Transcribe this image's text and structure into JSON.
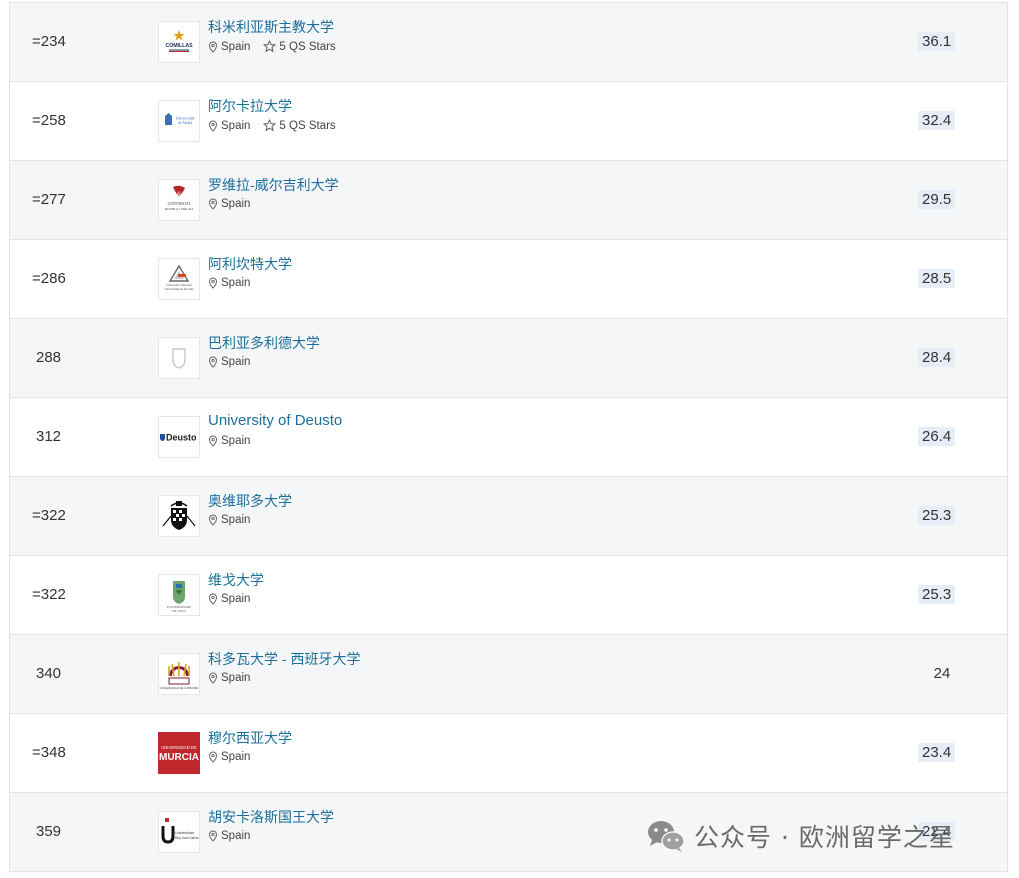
{
  "rows": [
    {
      "rank": "=234",
      "name": "科米利亚斯主教大学",
      "location": "Spain",
      "stars": "5 QS Stars",
      "score": "36.1",
      "logo": "comillas"
    },
    {
      "rank": "=258",
      "name": "阿尔卡拉大学",
      "location": "Spain",
      "stars": "5 QS Stars",
      "score": "32.4",
      "logo": "alcala"
    },
    {
      "rank": "=277",
      "name": "罗维拉-威尔吉利大学",
      "location": "Spain",
      "stars": "",
      "score": "29.5",
      "logo": "rovira"
    },
    {
      "rank": "=286",
      "name": "阿利坎特大学",
      "location": "Spain",
      "stars": "",
      "score": "28.5",
      "logo": "alicante"
    },
    {
      "rank": "288",
      "name": "巴利亚多利德大学",
      "location": "Spain",
      "stars": "",
      "score": "28.4",
      "logo": "valladolid"
    },
    {
      "rank": "312",
      "name": "University of Deusto",
      "location": "Spain",
      "stars": "",
      "score": "26.4",
      "logo": "deusto"
    },
    {
      "rank": "=322",
      "name": "奥维耶多大学",
      "location": "Spain",
      "stars": "",
      "score": "25.3",
      "logo": "oviedo"
    },
    {
      "rank": "=322",
      "name": "维戈大学",
      "location": "Spain",
      "stars": "",
      "score": "25.3",
      "logo": "vigo"
    },
    {
      "rank": "340",
      "name": "科多瓦大学 - 西班牙大学",
      "location": "Spain",
      "stars": "",
      "score": "24",
      "logo": "cordoba"
    },
    {
      "rank": "=348",
      "name": "穆尔西亚大学",
      "location": "Spain",
      "stars": "",
      "score": "23.4",
      "logo": "murcia"
    },
    {
      "rank": "359",
      "name": "胡安卡洛斯国王大学",
      "location": "Spain",
      "stars": "",
      "score": "22.4",
      "logo": "rjc"
    }
  ],
  "logo_text": {
    "comillas": "COMILLAS",
    "alcala": "Universidad de Alcalá",
    "rovira": "UNIVERSITAT ROVIRA I VIRGILI",
    "alicante": "Universitat d'Alacant Universidad de Alicante",
    "deusto": "Deusto",
    "vigo": "UNIVERSIDADE DE VIGO",
    "cordoba": "UNIVERSIDAD DE CÓRDOBA",
    "murcia_top": "UNIVERSIDAD DE",
    "murcia_main": "MURCIA",
    "rjc": "Universidad Rey Juan Carlos"
  },
  "watermark": {
    "text": "公众号 · 欧洲留学之星"
  },
  "colors": {
    "link": "#1b6f9a",
    "score_bg": "#e6edf7",
    "alt_row": "#f5f6f8",
    "murcia": "#c0272d"
  }
}
